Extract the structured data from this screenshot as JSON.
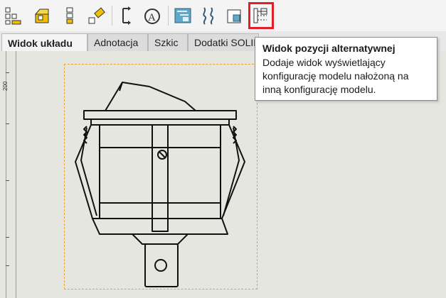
{
  "toolbar": {
    "buttons": [
      {
        "name": "standard-3-view-icon"
      },
      {
        "name": "model-view-icon"
      },
      {
        "name": "projected-view-icon"
      },
      {
        "name": "auxiliary-view-icon"
      },
      {
        "name": "section-view-icon"
      },
      {
        "name": "detail-view-icon"
      },
      {
        "name": "broken-out-section-icon"
      },
      {
        "name": "break-view-icon"
      },
      {
        "name": "crop-view-icon"
      },
      {
        "name": "alternate-position-view-icon",
        "selected": true
      }
    ],
    "highlight_color": "#e01f26"
  },
  "tabs": [
    {
      "label": "Widok układu",
      "active": true
    },
    {
      "label": "Adnotacja",
      "active": false
    },
    {
      "label": "Szkic",
      "active": false
    },
    {
      "label": "Dodatki SOLIDWORKS",
      "active": false
    }
  ],
  "ruler": {
    "label": "200"
  },
  "tooltip": {
    "title": "Widok pozycji alternatywnej",
    "body": "Dodaje widok wyświetlający konfigurację modelu nałożoną na inną konfigurację modelu."
  },
  "colors": {
    "view_border": "#f0a030",
    "canvas_bg": "#e6e6e1"
  }
}
